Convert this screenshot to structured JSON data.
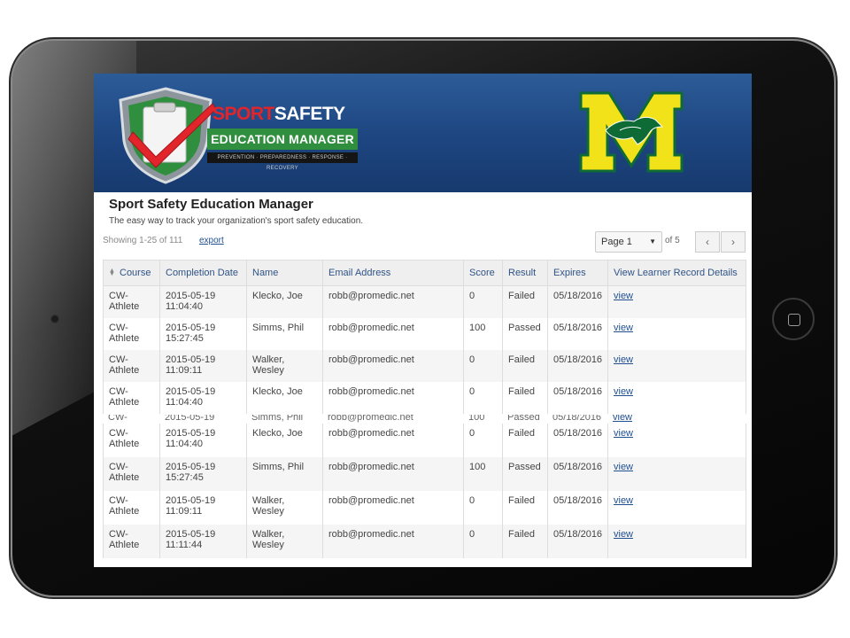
{
  "brand": {
    "sport": "SPORT",
    "safety": "SAFETY",
    "band": "EDUCATION MANAGER",
    "tagline": "PREVENTION · PREPAREDNESS · RESPONSE · RECOVERY"
  },
  "icons": {
    "shield": "shield-clipboard-check-icon",
    "school": "school-m-mustang-logo"
  },
  "colors": {
    "banner": "#1d4580",
    "accent_red": "#e2242b",
    "accent_green": "#2f8f3e",
    "school_yellow": "#f2e21a",
    "school_green": "#0e6b36",
    "link": "#1f4f8f"
  },
  "header": {
    "title": "Sport Safety Education Manager",
    "subtitle": "The easy way to track your organization's sport safety education."
  },
  "toolbar": {
    "showing": "Showing 1-25 of 111",
    "export_label": "export",
    "page_select_value": "Page 1",
    "of_pages": "of 5",
    "prev_label": "‹",
    "next_label": "›"
  },
  "table": {
    "columns": {
      "course": "Course",
      "completion_date": "Completion Date",
      "name": "Name",
      "email": "Email Address",
      "score": "Score",
      "result": "Result",
      "expires": "Expires",
      "details": "View Learner Record Details"
    },
    "rows": [
      {
        "course": "CW-Athlete",
        "date": "2015-05-19",
        "time": "11:04:40",
        "name": "Klecko, Joe",
        "email": "robb@promedic.net",
        "score": "0",
        "result": "Failed",
        "expires": "05/18/2016",
        "link": "view"
      },
      {
        "course": "CW-Athlete",
        "date": "2015-05-19",
        "time": "15:27:45",
        "name": "Simms, Phil",
        "email": "robb@promedic.net",
        "score": "100",
        "result": "Passed",
        "expires": "05/18/2016",
        "link": "view"
      },
      {
        "course": "CW-Athlete",
        "date": "2015-05-19",
        "time": "11:09:11",
        "name": "Walker, Wesley",
        "email": "robb@promedic.net",
        "score": "0",
        "result": "Failed",
        "expires": "05/18/2016",
        "link": "view"
      },
      {
        "course": "CW-Athlete",
        "date": "2015-05-19",
        "time": "11:04:40",
        "name": "Klecko, Joe",
        "email": "robb@promedic.net",
        "score": "0",
        "result": "Failed",
        "expires": "05/18/2016",
        "link": "view"
      }
    ],
    "seam_row": {
      "course": "CW-",
      "date": "2015-05-19",
      "name": "Simms, Phil",
      "email": "robb@promedic.net",
      "score": "100",
      "result": "Passed",
      "expires": "05/18/2016",
      "link": "view"
    },
    "rows2": [
      {
        "course": "CW-Athlete",
        "date": "2015-05-19",
        "time": "11:04:40",
        "name": "Klecko, Joe",
        "email": "robb@promedic.net",
        "score": "0",
        "result": "Failed",
        "expires": "05/18/2016",
        "link": "view"
      },
      {
        "course": "CW-Athlete",
        "date": "2015-05-19",
        "time": "15:27:45",
        "name": "Simms, Phil",
        "email": "robb@promedic.net",
        "score": "100",
        "result": "Passed",
        "expires": "05/18/2016",
        "link": "view"
      },
      {
        "course": "CW-Athlete",
        "date": "2015-05-19",
        "time": "11:09:11",
        "name": "Walker, Wesley",
        "email": "robb@promedic.net",
        "score": "0",
        "result": "Failed",
        "expires": "05/18/2016",
        "link": "view"
      },
      {
        "course": "CW-Athlete",
        "date": "2015-05-19",
        "time": "11:11:44",
        "name": "Walker, Wesley",
        "email": "robb@promedic.net",
        "score": "0",
        "result": "Failed",
        "expires": "05/18/2016",
        "link": "view"
      }
    ]
  }
}
